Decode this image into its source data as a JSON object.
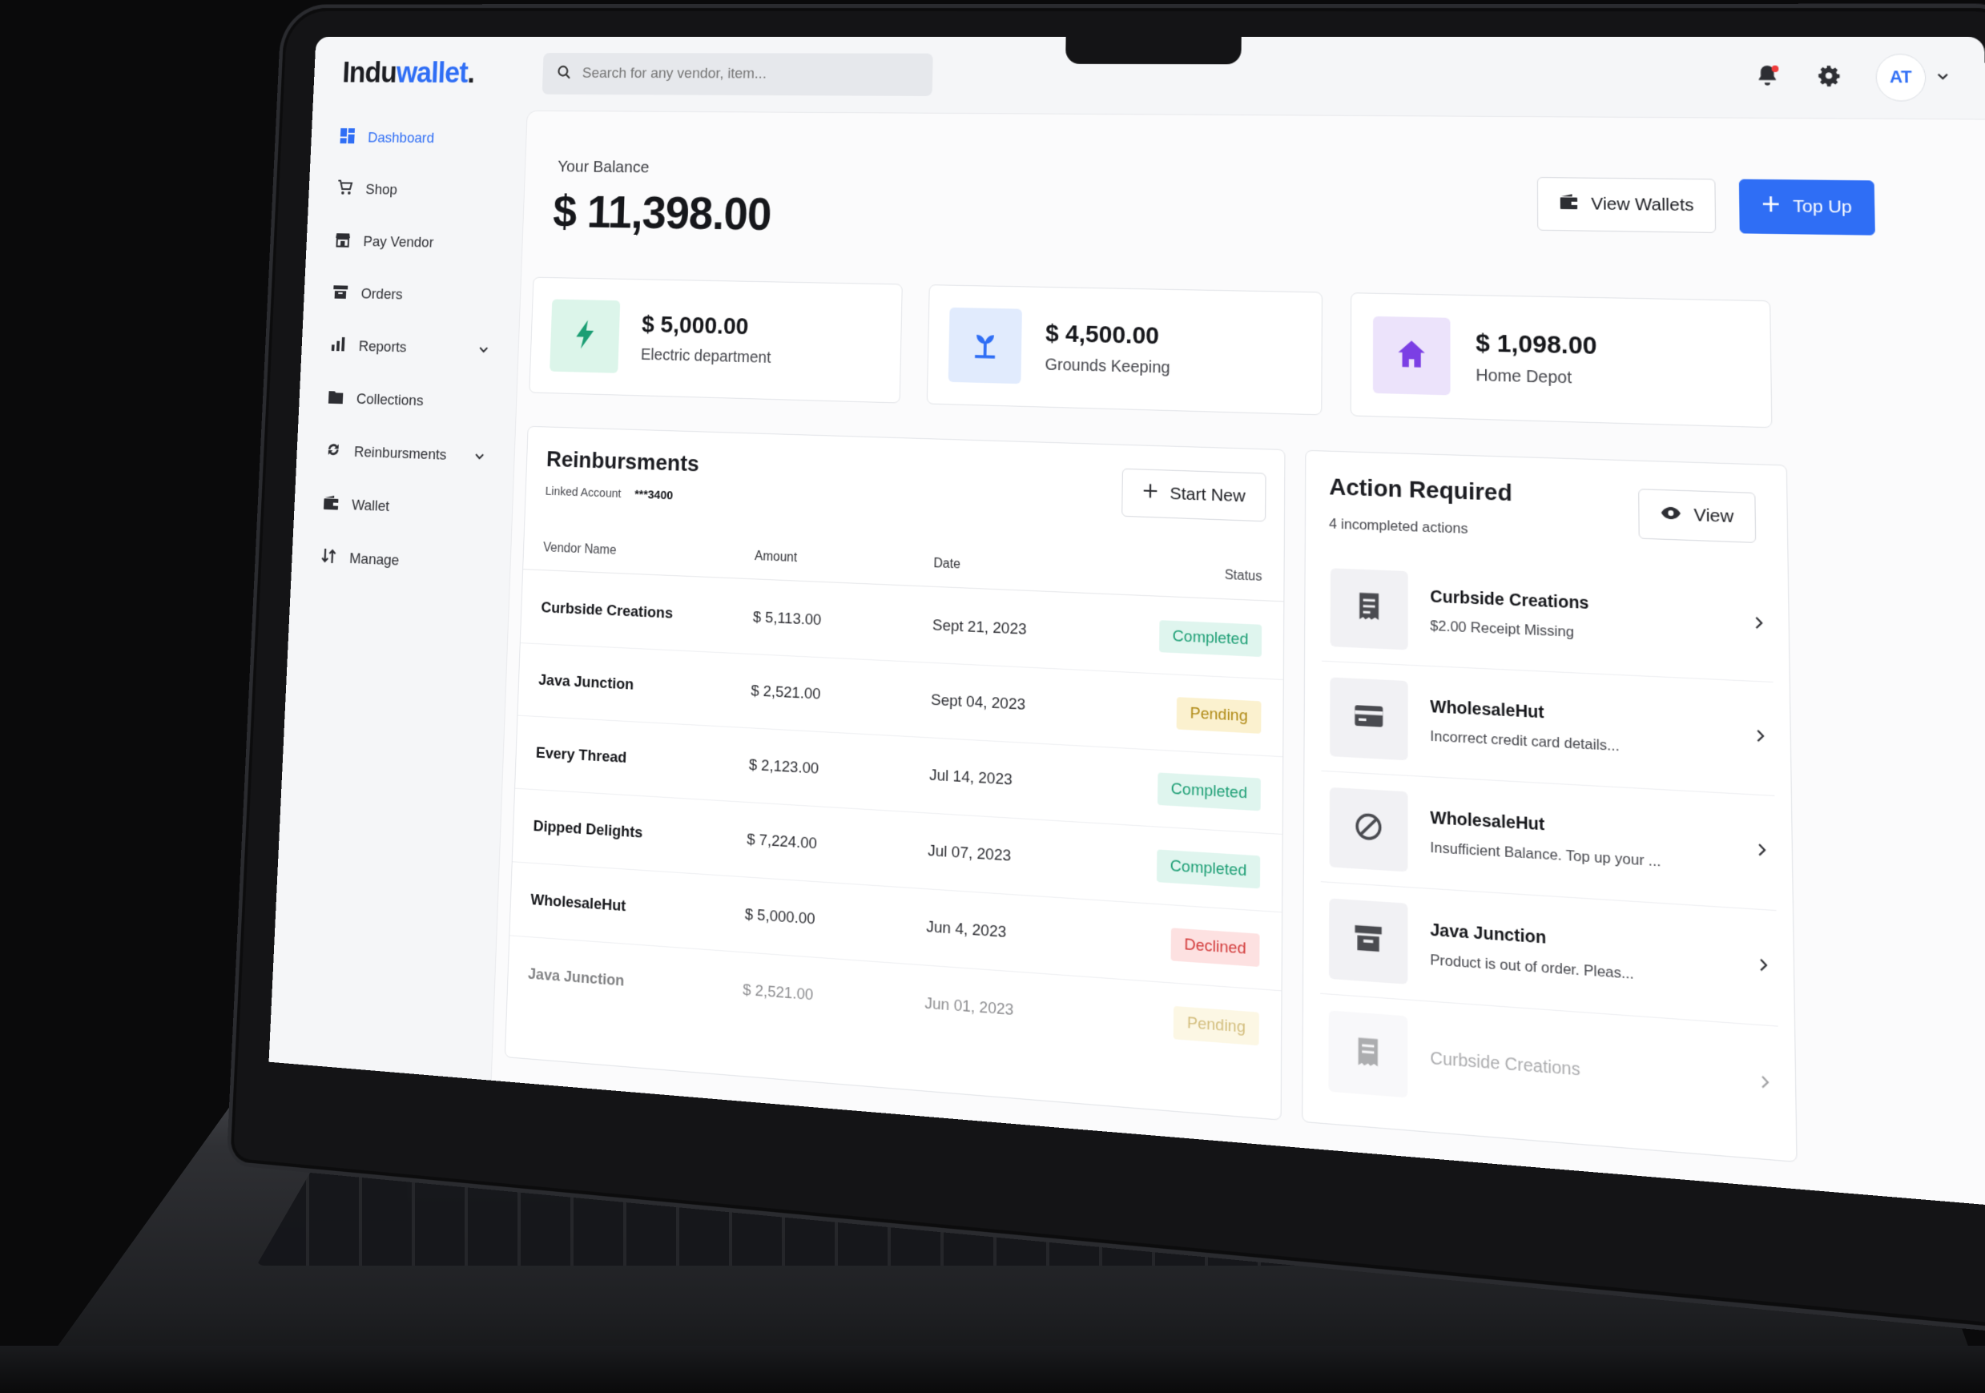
{
  "app": {
    "logo_part1": "Indu",
    "logo_part2": "wallet",
    "logo_dot": "."
  },
  "search": {
    "placeholder": "Search for any vendor, item..."
  },
  "user": {
    "initials": "AT"
  },
  "sidebar": {
    "items": [
      {
        "label": "Dashboard",
        "icon": "dashboard-icon",
        "active": true
      },
      {
        "label": "Shop",
        "icon": "cart-icon"
      },
      {
        "label": "Pay Vendor",
        "icon": "store-icon"
      },
      {
        "label": "Orders",
        "icon": "box-icon"
      },
      {
        "label": "Reports",
        "icon": "bar-chart-icon",
        "has_submenu": true
      },
      {
        "label": "Collections",
        "icon": "folder-icon"
      },
      {
        "label": "Reinbursments",
        "icon": "refresh-icon",
        "has_submenu": true
      },
      {
        "label": "Wallet",
        "icon": "wallet-icon"
      },
      {
        "label": "Manage",
        "icon": "sort-icon"
      }
    ]
  },
  "balance": {
    "label": "Your Balance",
    "value": "$ 11,398.00"
  },
  "actions": {
    "view_wallets": "View Wallets",
    "top_up": "Top Up"
  },
  "stats": [
    {
      "amount": "$ 5,000.00",
      "label": "Electric department",
      "icon": "lightning-icon",
      "bg": "#dcf5ea",
      "fg": "#1c9e74"
    },
    {
      "amount": "$ 4,500.00",
      "label": "Grounds Keeping",
      "icon": "plant-icon",
      "bg": "#e1ebfd",
      "fg": "#2f6ef5"
    },
    {
      "amount": "$ 1,098.00",
      "label": "Home Depot",
      "icon": "house-icon",
      "bg": "#ece3fb",
      "fg": "#7b3fe4"
    }
  ],
  "reimbursements": {
    "title": "Reinbursments",
    "linked_label": "Linked Account",
    "linked_account": "***3400",
    "start_new": "Start New",
    "columns": [
      "Vendor Name",
      "Amount",
      "Date",
      "Status"
    ],
    "rows": [
      {
        "vendor": "Curbside Creations",
        "amount": "$ 5,113.00",
        "date": "Sept 21, 2023",
        "status": "Completed"
      },
      {
        "vendor": "Java Junction",
        "amount": "$ 2,521.00",
        "date": "Sept 04, 2023",
        "status": "Pending"
      },
      {
        "vendor": "Every Thread",
        "amount": "$ 2,123.00",
        "date": "Jul 14, 2023",
        "status": "Completed"
      },
      {
        "vendor": "Dipped Delights",
        "amount": "$ 7,224.00",
        "date": "Jul 07, 2023",
        "status": "Completed"
      },
      {
        "vendor": "WholesaleHut",
        "amount": "$ 5,000.00",
        "date": "Jun 4, 2023",
        "status": "Declined"
      },
      {
        "vendor": "Java Junction",
        "amount": "$ 2,521.00",
        "date": "Jun 01, 2023",
        "status": "Pending"
      }
    ]
  },
  "action_required": {
    "title": "Action Required",
    "subtitle": "4 incompleted actions",
    "view": "View",
    "items": [
      {
        "name": "Curbside Creations",
        "desc": "$2.00 Receipt Missing",
        "icon": "receipt-icon"
      },
      {
        "name": "WholesaleHut",
        "desc": "Incorrect credit card details...",
        "icon": "credit-card-icon"
      },
      {
        "name": "WholesaleHut",
        "desc": "Insufficient Balance. Top up your ...",
        "icon": "blocked-icon"
      },
      {
        "name": "Java Junction",
        "desc": "Product is out of order. Pleas...",
        "icon": "archive-icon"
      },
      {
        "name": "Curbside Creations",
        "desc": "",
        "icon": "receipt-icon"
      }
    ]
  }
}
